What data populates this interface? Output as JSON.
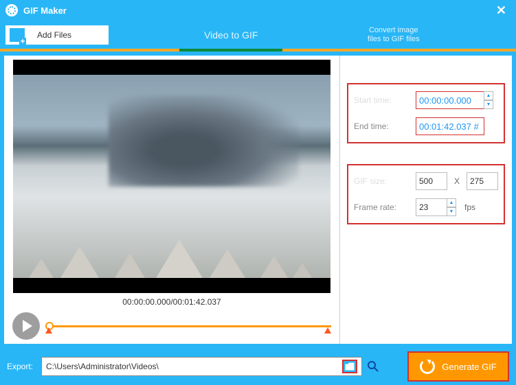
{
  "app": {
    "title": "GIF Maker"
  },
  "toolbar": {
    "add_files": "Add Files"
  },
  "tabs": {
    "video_to_gif": "Video to GIF",
    "convert_line1": "Convert image",
    "convert_line2": "files to GIF files"
  },
  "preview": {
    "time_display": "00:00:00.000/00:01:42.037"
  },
  "time_panel": {
    "start_label": "Start time:",
    "start_value": "00:00:00.000",
    "end_label": "End time:",
    "end_value": "00:01:42.037 #"
  },
  "size_panel": {
    "size_label": "GIF size:",
    "width": "500",
    "x": "X",
    "height": "275",
    "fps_label": "Frame rate:",
    "fps_value": "23",
    "fps_unit": "fps"
  },
  "footer": {
    "export_label": "Export:",
    "path": "C:\\Users\\Administrator\\Videos\\",
    "generate": "Generate GIF"
  }
}
